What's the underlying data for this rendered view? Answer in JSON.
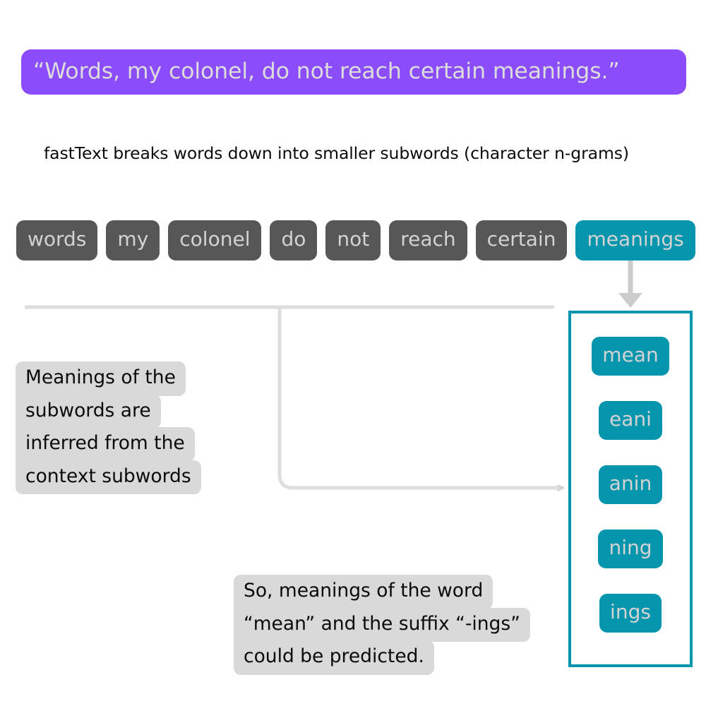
{
  "banner": {
    "quote": "“Words, my colonel, do not reach certain meanings.”",
    "color": "#8b4dfb",
    "text_color": "#dcdcdc"
  },
  "subtitle": {
    "text": "fastText breaks words down into smaller subwords (character n-grams)"
  },
  "sentence": {
    "words": [
      {
        "label": "words",
        "highlighted": false
      },
      {
        "label": "my",
        "highlighted": false
      },
      {
        "label": "colonel",
        "highlighted": false
      },
      {
        "label": "do",
        "highlighted": false
      },
      {
        "label": "not",
        "highlighted": false
      },
      {
        "label": "reach",
        "highlighted": false
      },
      {
        "label": "certain",
        "highlighted": false
      },
      {
        "label": "meanings",
        "highlighted": true
      }
    ],
    "chip_color": "#575757",
    "chip_text_color": "#d3d3d3",
    "highlight_color": "#0596ae"
  },
  "subwords": {
    "panel_border_color": "#0596ae",
    "chip_color": "#0596ae",
    "chip_text_color": "#d3d3d3",
    "items": [
      {
        "label": "mean"
      },
      {
        "label": "eani"
      },
      {
        "label": "anin"
      },
      {
        "label": "ning"
      },
      {
        "label": "ings"
      }
    ]
  },
  "callouts": {
    "left": {
      "lines": [
        "Meanings of the",
        "subwords are",
        "inferred from the",
        "context subwords"
      ],
      "bg_color": "#d9d9d9",
      "text_color": "#0b0b0b"
    },
    "bottom": {
      "lines": [
        "So, meanings of the word",
        "“mean” and the suffix “-ings”",
        "could be predicted."
      ],
      "bg_color": "#d9d9d9",
      "text_color": "#0b0b0b"
    }
  },
  "connectors": {
    "line_color": "#dcdcdc",
    "arrow_color": "#c8c8c8"
  }
}
